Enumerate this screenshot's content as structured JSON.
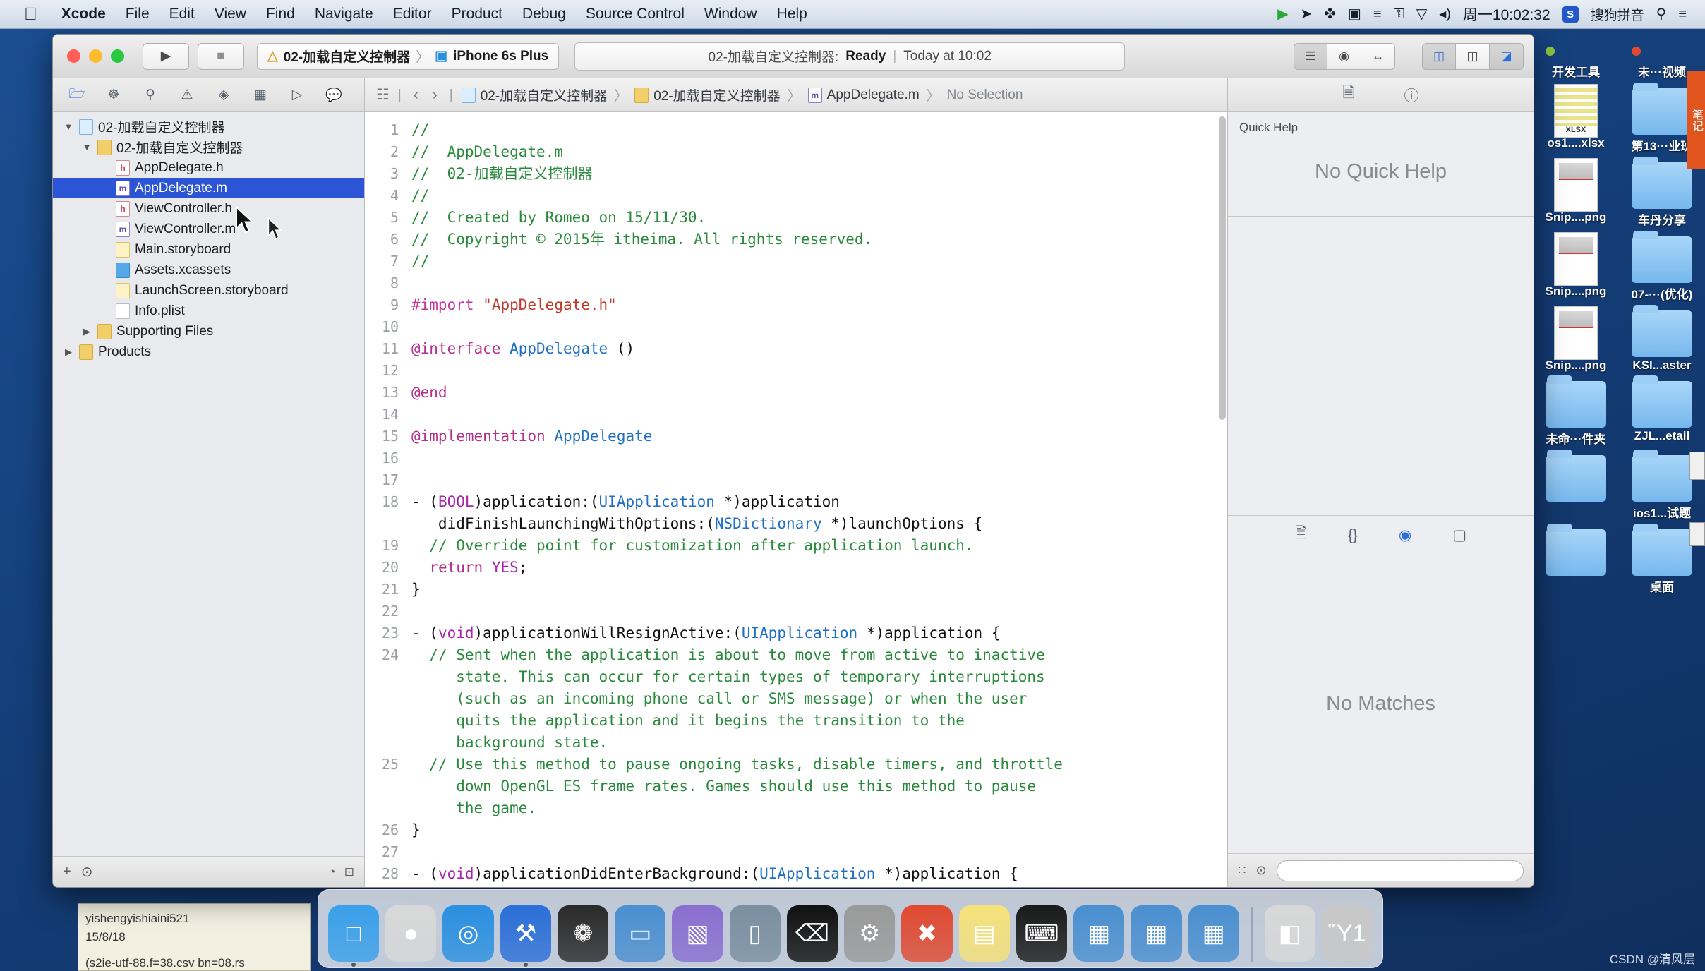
{
  "menubar": {
    "apple_icon": "apple-icon",
    "items": [
      {
        "label": "Xcode",
        "bold": true
      },
      {
        "label": "File",
        "bold": false
      },
      {
        "label": "Edit",
        "bold": false
      },
      {
        "label": "View",
        "bold": false
      },
      {
        "label": "Find",
        "bold": false
      },
      {
        "label": "Navigate",
        "bold": false
      },
      {
        "label": "Editor",
        "bold": false
      },
      {
        "label": "Product",
        "bold": false
      },
      {
        "label": "Debug",
        "bold": false
      },
      {
        "label": "Source Control",
        "bold": false
      },
      {
        "label": "Window",
        "bold": false
      },
      {
        "label": "Help",
        "bold": false
      }
    ],
    "status_icons": [
      {
        "name": "screen-record-icon",
        "glyph": "▶"
      },
      {
        "name": "location-icon",
        "glyph": "➤"
      },
      {
        "name": "bluetooth-icon",
        "glyph": "✤"
      },
      {
        "name": "camera-icon",
        "glyph": "▣"
      },
      {
        "name": "sliders-icon",
        "glyph": "≡"
      },
      {
        "name": "lock-icon",
        "glyph": "⚿"
      },
      {
        "name": "wifi-icon",
        "glyph": "▽"
      },
      {
        "name": "volume-icon",
        "glyph": "◂)"
      }
    ],
    "clock": "周一10:02:32",
    "input_method_badge": "S",
    "input_method": "搜狗拼音",
    "search_icon": "search-icon",
    "control_center_icon": "list-icon"
  },
  "xcode": {
    "traffic": {
      "close": "#ff5f57",
      "minimize": "#febb2e",
      "zoom": "#28c840"
    },
    "toolbar": {
      "run_icon": "▶",
      "stop_icon": "■",
      "scheme_project": "02-加载自定义控制器",
      "scheme_sep": "〉",
      "scheme_device": "iPhone 6s Plus",
      "status_title": "02-加载自定义控制器:",
      "status_state": "Ready",
      "status_sep": "|",
      "status_time": "Today at 10:02",
      "editor_buttons": [
        "standard-editor",
        "assistant-editor",
        "version-editor"
      ],
      "view_buttons": [
        "navigator-toggle",
        "debug-toggle",
        "utilities-toggle"
      ]
    },
    "navigator": {
      "tabs": [
        "project-navigator",
        "symbol-navigator",
        "find-navigator",
        "issue-navigator",
        "test-navigator",
        "debug-navigator",
        "breakpoint-navigator",
        "report-navigator"
      ],
      "tree": [
        {
          "label": "02-加载自定义控制器",
          "indent": 0,
          "twisty": "▼",
          "icon": "project",
          "selected": false
        },
        {
          "label": "02-加载自定义控制器",
          "indent": 1,
          "twisty": "▼",
          "icon": "folder",
          "selected": false
        },
        {
          "label": "AppDelegate.h",
          "indent": 2,
          "twisty": "",
          "icon": "h",
          "selected": false
        },
        {
          "label": "AppDelegate.m",
          "indent": 2,
          "twisty": "",
          "icon": "m",
          "selected": true
        },
        {
          "label": "ViewController.h",
          "indent": 2,
          "twisty": "",
          "icon": "h",
          "selected": false
        },
        {
          "label": "ViewController.m",
          "indent": 2,
          "twisty": "",
          "icon": "m",
          "selected": false
        },
        {
          "label": "Main.storyboard",
          "indent": 2,
          "twisty": "",
          "icon": "sb",
          "selected": false
        },
        {
          "label": "Assets.xcassets",
          "indent": 2,
          "twisty": "",
          "icon": "assets",
          "selected": false
        },
        {
          "label": "LaunchScreen.storyboard",
          "indent": 2,
          "twisty": "",
          "icon": "sb",
          "selected": false
        },
        {
          "label": "Info.plist",
          "indent": 2,
          "twisty": "",
          "icon": "plist",
          "selected": false
        },
        {
          "label": "Supporting Files",
          "indent": 1,
          "twisty": "▶",
          "icon": "folder",
          "selected": false
        },
        {
          "label": "Products",
          "indent": 0,
          "twisty": "▶",
          "icon": "folder",
          "selected": false
        }
      ],
      "footer": {
        "add": "+",
        "filter": "⊙",
        "right_a": "◔",
        "right_b": "⊡"
      }
    },
    "jumpbar": {
      "related_icon": "related-items-icon",
      "back": "‹",
      "forward": "›",
      "crumbs": [
        {
          "label": "02-加载自定义控制器",
          "icon": "project"
        },
        {
          "label": "02-加载自定义控制器",
          "icon": "folder"
        },
        {
          "label": "AppDelegate.m",
          "icon": "m"
        },
        {
          "label": "No Selection",
          "icon": ""
        }
      ]
    },
    "editor": {
      "filename": "AppDelegate.m",
      "lines": [
        {
          "n": "1",
          "html": "<span class=\"cmt\">//</span>"
        },
        {
          "n": "2",
          "html": "<span class=\"cmt\">//  AppDelegate.m</span>"
        },
        {
          "n": "3",
          "html": "<span class=\"cmt\">//  02-加载自定义控制器</span>"
        },
        {
          "n": "4",
          "html": "<span class=\"cmt\">//</span>"
        },
        {
          "n": "5",
          "html": "<span class=\"cmt\">//  Created by Romeo on 15/11/30.</span>"
        },
        {
          "n": "6",
          "html": "<span class=\"cmt\">//  Copyright © 2015年 itheima. All rights reserved.</span>"
        },
        {
          "n": "7",
          "html": "<span class=\"cmt\">//</span>"
        },
        {
          "n": "8",
          "html": ""
        },
        {
          "n": "9",
          "html": "<span class=\"pre\">#import</span> <span class=\"str\">\"AppDelegate.h\"</span>"
        },
        {
          "n": "10",
          "html": ""
        },
        {
          "n": "11",
          "html": "<span class=\"kw\">@interface</span> <span class=\"typ\">AppDelegate</span> ()"
        },
        {
          "n": "12",
          "html": ""
        },
        {
          "n": "13",
          "html": "<span class=\"kw\">@end</span>"
        },
        {
          "n": "14",
          "html": ""
        },
        {
          "n": "15",
          "html": "<span class=\"kw\">@implementation</span> <span class=\"typ\">AppDelegate</span>"
        },
        {
          "n": "16",
          "html": ""
        },
        {
          "n": "17",
          "html": ""
        },
        {
          "n": "18",
          "html": "- (<span class=\"kw2\">BOOL</span>)application:(<span class=\"typ\">UIApplication</span> *)application\n   didFinishLaunchingWithOptions:(<span class=\"typ\">NSDictionary</span> *)launchOptions {"
        },
        {
          "n": "19",
          "html": "  <span class=\"cmt\">// Override point for customization after application launch.</span>"
        },
        {
          "n": "20",
          "html": "  <span class=\"kw\">return</span> <span class=\"kw2\">YES</span>;"
        },
        {
          "n": "21",
          "html": "}"
        },
        {
          "n": "22",
          "html": ""
        },
        {
          "n": "23",
          "html": "- (<span class=\"kw2\">void</span>)applicationWillResignActive:(<span class=\"typ\">UIApplication</span> *)application {"
        },
        {
          "n": "24",
          "html": "  <span class=\"cmt\">// Sent when the application is about to move from active to inactive\n     state. This can occur for certain types of temporary interruptions\n     (such as an incoming phone call or SMS message) or when the user\n     quits the application and it begins the transition to the\n     background state.</span>"
        },
        {
          "n": "25",
          "html": "  <span class=\"cmt\">// Use this method to pause ongoing tasks, disable timers, and throttle\n     down OpenGL ES frame rates. Games should use this method to pause\n     the game.</span>"
        },
        {
          "n": "26",
          "html": "}"
        },
        {
          "n": "27",
          "html": ""
        },
        {
          "n": "28",
          "html": "- (<span class=\"kw2\">void</span>)applicationDidEnterBackground:(<span class=\"typ\">UIApplication</span> *)application {"
        }
      ]
    },
    "utilities": {
      "inspector_tabs": [
        "file-inspector",
        "quick-help-inspector"
      ],
      "quick_help_title": "Quick Help",
      "quick_help_body": "No Quick Help",
      "library_tabs": [
        "file-template-library",
        "code-snippet-library",
        "object-library",
        "media-library"
      ],
      "library_body": "No Matches",
      "library_footer": {
        "grid_icon": "∷",
        "filter_icon": "⊙",
        "search_placeholder": ""
      }
    }
  },
  "desktop": {
    "icons": [
      {
        "label": "开发工具",
        "type": "tag-green"
      },
      {
        "label": "未···视频",
        "type": "tag-red"
      },
      {
        "label": "os1....xlsx",
        "type": "xlsx"
      },
      {
        "label": "第13···业班",
        "type": "folder"
      },
      {
        "label": "Snip....png",
        "type": "png"
      },
      {
        "label": "车丹分享",
        "type": "folder"
      },
      {
        "label": "Snip....png",
        "type": "png"
      },
      {
        "label": "07-···(优化)",
        "type": "folder"
      },
      {
        "label": "Snip....png",
        "type": "png"
      },
      {
        "label": "KSI...aster",
        "type": "folder"
      },
      {
        "label": "未命···件夹",
        "type": "folder"
      },
      {
        "label": "ZJL...etail",
        "type": "folder"
      },
      {
        "label": "",
        "type": "folder"
      },
      {
        "label": "ios1...试题",
        "type": "folder"
      },
      {
        "label": "",
        "type": "folder"
      },
      {
        "label": "桌面",
        "type": "folder"
      }
    ],
    "orange_tab": "笔记",
    "note": {
      "line1": "yishengyishiaini521",
      "line2": "15/8/18",
      "line3": "(s2ie-utf-88.f=38.csv  bn=08.rs"
    },
    "watermark": "CSDN @清风层"
  },
  "dock": {
    "items": [
      {
        "name": "finder",
        "glyph": "□",
        "color": "#3aa0ea",
        "running": true
      },
      {
        "name": "launchpad",
        "glyph": "●",
        "color": "#d8d8d8",
        "running": false
      },
      {
        "name": "safari",
        "glyph": "◎",
        "color": "#2b8fe0",
        "running": false
      },
      {
        "name": "xcode",
        "glyph": "⚒",
        "color": "#2b6fd8",
        "running": true
      },
      {
        "name": "photos",
        "glyph": "❁",
        "color": "#2a2a2a",
        "running": false
      },
      {
        "name": "simulator",
        "glyph": "▭",
        "color": "#4a8fd0",
        "running": false
      },
      {
        "name": "instruments",
        "glyph": "▧",
        "color": "#8a6fd0",
        "running": false
      },
      {
        "name": "device",
        "glyph": "▯",
        "color": "#7a8fa0",
        "running": false
      },
      {
        "name": "terminal",
        "glyph": "⌫",
        "color": "#111111",
        "running": false
      },
      {
        "name": "system-preferences",
        "glyph": "⚙",
        "color": "#9a9a9a",
        "running": false
      },
      {
        "name": "xmind",
        "glyph": "✖",
        "color": "#e04a32",
        "running": false
      },
      {
        "name": "notes",
        "glyph": "▤",
        "color": "#f5e27a",
        "running": false
      },
      {
        "name": "iterm",
        "glyph": "⌨",
        "color": "#1a1a1a",
        "running": false
      },
      {
        "name": "folder-blue-1",
        "glyph": "▦",
        "color": "#4a8fd0",
        "running": false
      },
      {
        "name": "folder-blue-2",
        "glyph": "▦",
        "color": "#4a8fd0",
        "running": false
      },
      {
        "name": "folder-blue-3",
        "glyph": "▦",
        "color": "#4a8fd0",
        "running": false
      },
      {
        "name": "downloads-stack",
        "glyph": "◧",
        "color": "#d8d8d8",
        "running": false
      },
      {
        "name": "trash",
        "glyph": "Ὕ1",
        "color": "#c8c8c8",
        "running": false
      }
    ]
  }
}
